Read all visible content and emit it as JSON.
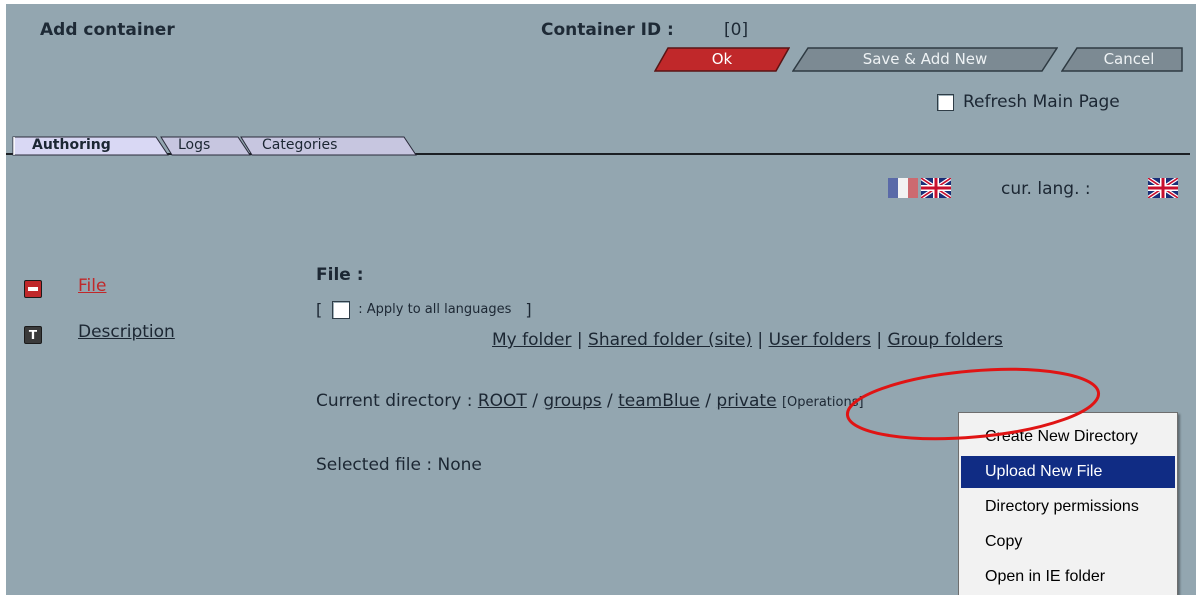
{
  "header": {
    "title": "Add container",
    "container_id_label": "Container ID :",
    "container_id_value": "[0]"
  },
  "buttons": {
    "ok": "Ok",
    "save_add_new": "Save & Add New",
    "cancel": "Cancel"
  },
  "refresh": {
    "label": "Refresh Main Page",
    "checked": false
  },
  "tabs": [
    {
      "label": "Authoring",
      "active": true
    },
    {
      "label": "Logs",
      "active": false
    },
    {
      "label": "Categories",
      "active": false
    }
  ],
  "language": {
    "current_label": "cur. lang. :"
  },
  "sidebar": {
    "items": [
      {
        "label": "File",
        "icon": "file-field-icon"
      },
      {
        "label": "Description",
        "icon": "text-field-icon",
        "icon_glyph": "T"
      }
    ]
  },
  "file_field": {
    "label": "File :",
    "apply_open": "[",
    "apply_label": ": Apply to all languages",
    "apply_close": "]"
  },
  "folders": {
    "items": [
      "My folder",
      "Shared folder (site)",
      "User folders",
      "Group folders"
    ],
    "separator": "|"
  },
  "current_directory": {
    "label": "Current directory :",
    "path": [
      "ROOT",
      "groups",
      "teamBlue",
      "private"
    ],
    "separator": "/",
    "operations_label": "[Operations]"
  },
  "selected_file": {
    "label": "Selected file :",
    "value": "None"
  },
  "context_menu": {
    "items": [
      "Create New Directory",
      "Upload New File",
      "Directory permissions",
      "Copy",
      "Open in IE folder"
    ],
    "highlighted": "Upload New File"
  },
  "colors": {
    "panel_bg": "#93a6b0",
    "ok_button": "#c0282a",
    "button_gray": "#7c8a93",
    "active_tab": "#d9d8f4",
    "inactive_tab": "#c7c6e0",
    "link_red": "#c0282a",
    "menu_highlight": "#102c84",
    "annotation": "#e01414"
  }
}
